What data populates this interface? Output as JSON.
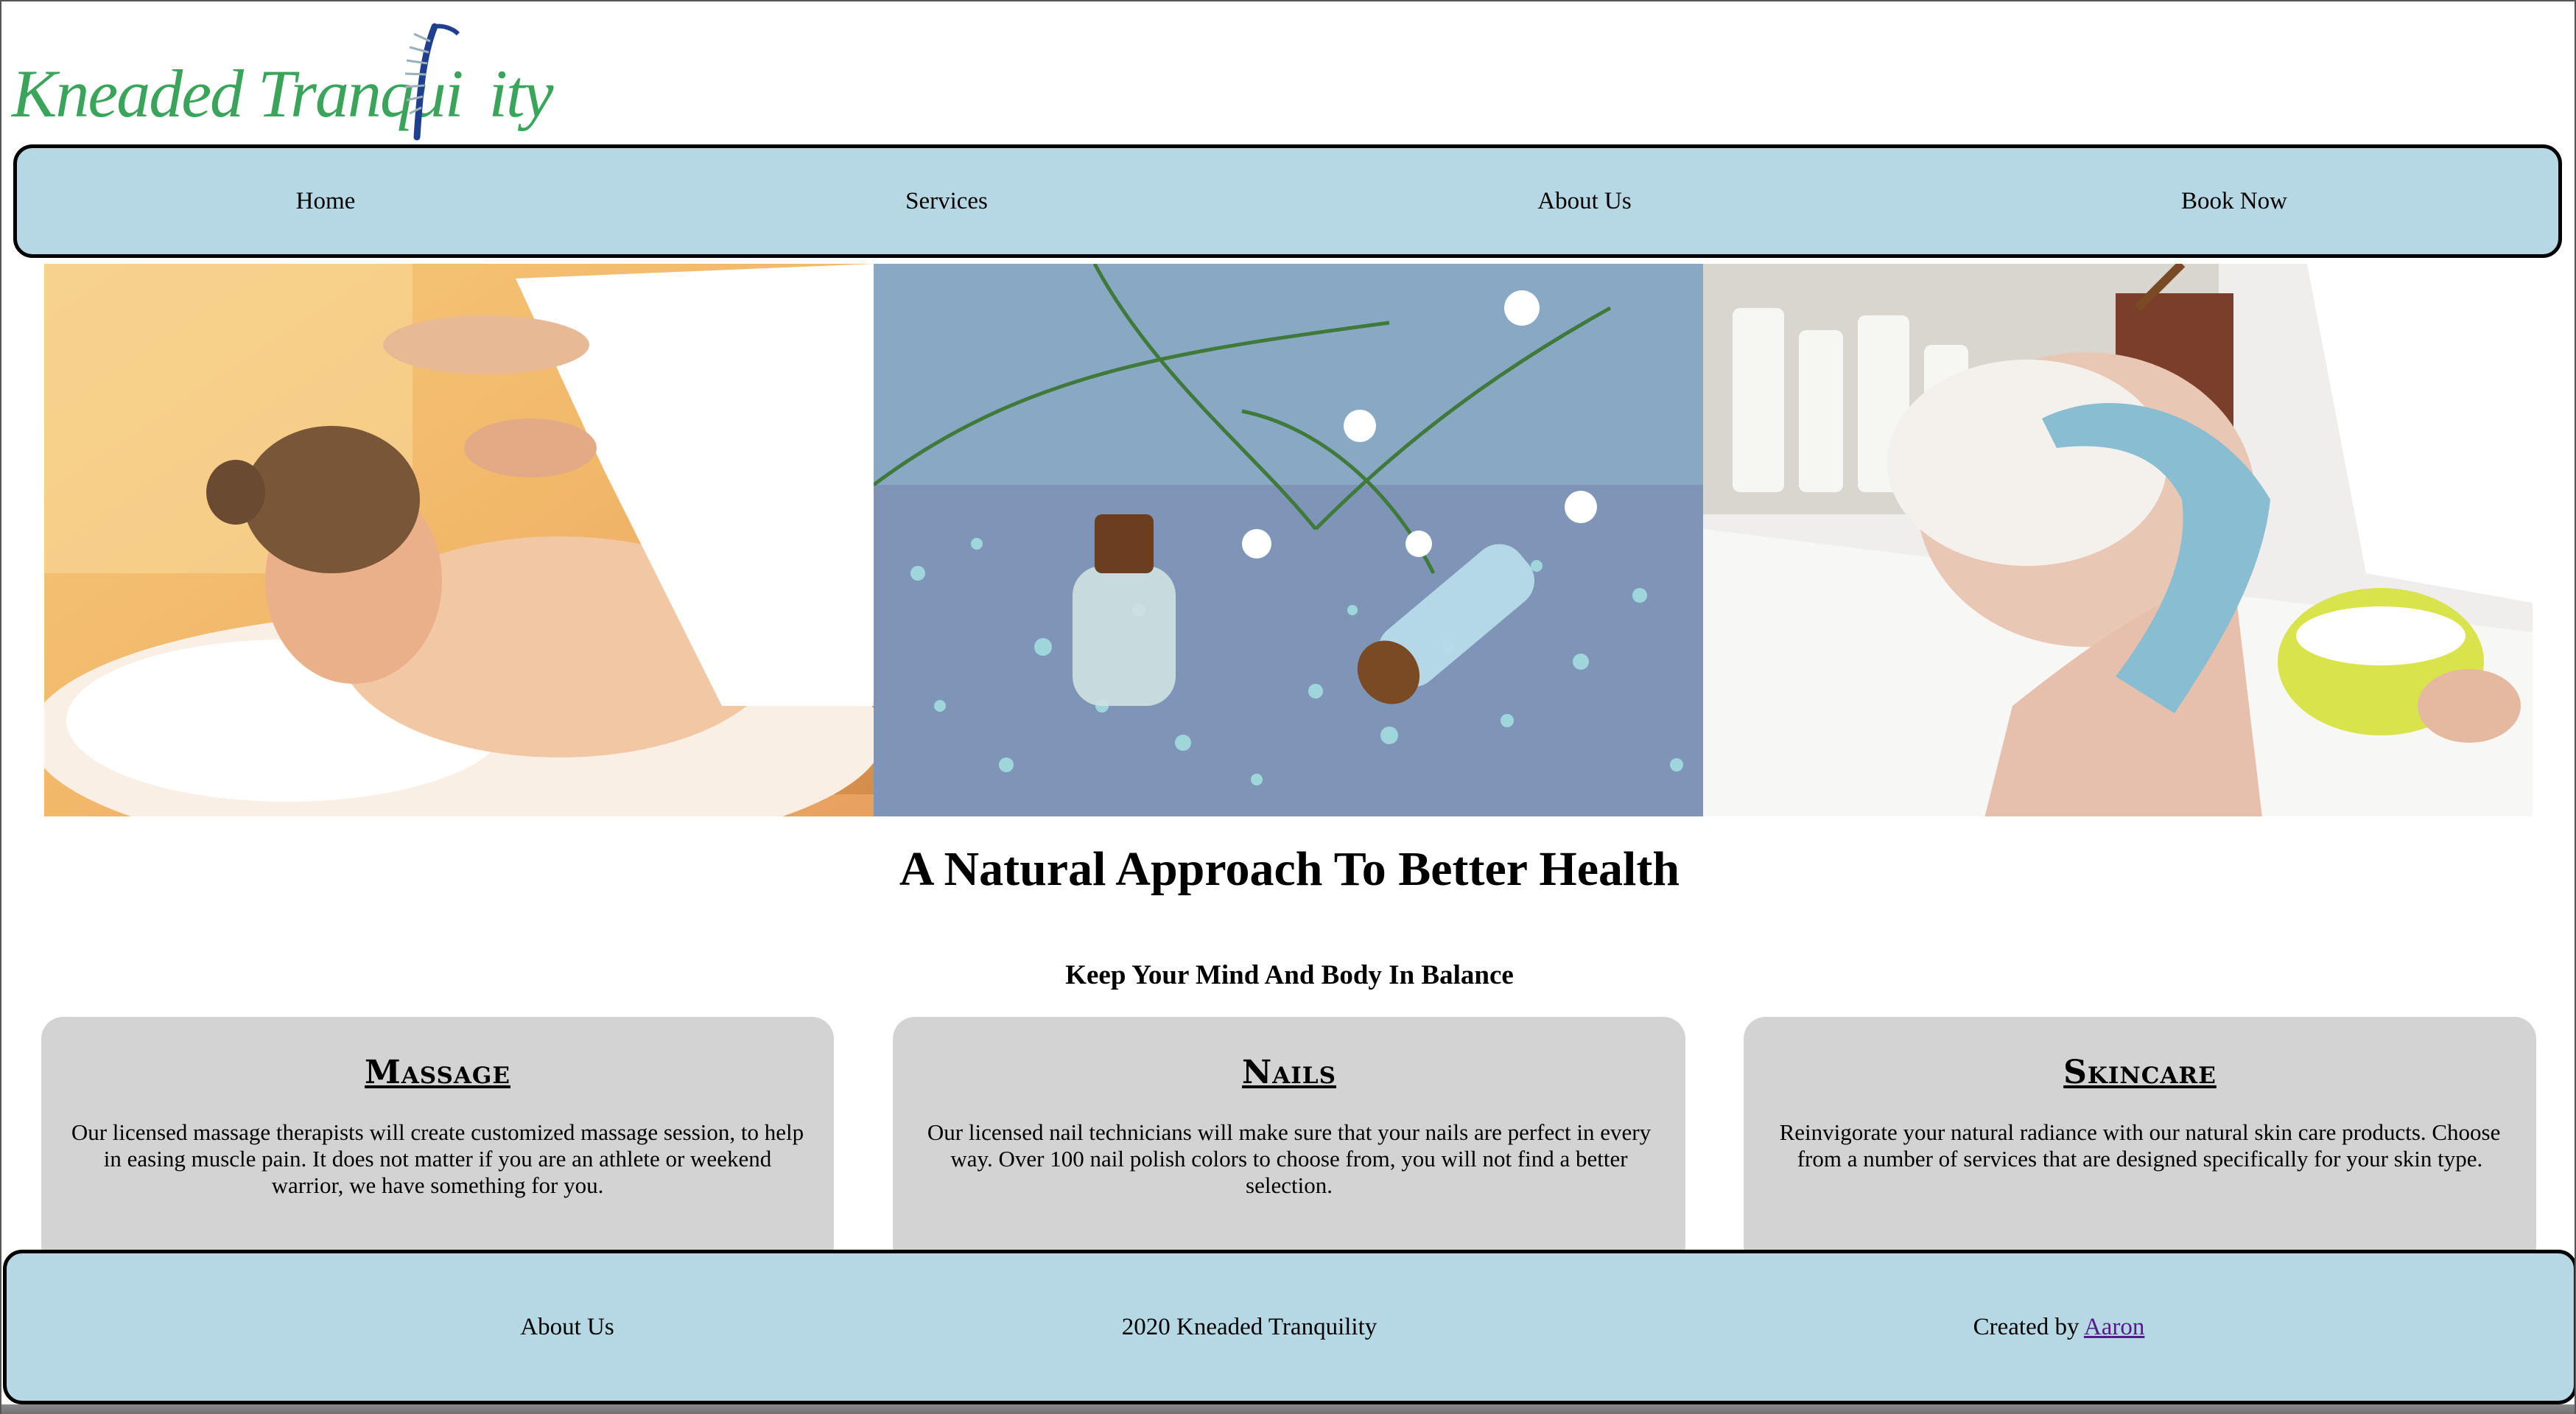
{
  "logo": {
    "text_before": "Kneaded Tranqui",
    "text_after": "ity"
  },
  "nav": {
    "items": [
      {
        "label": "Home"
      },
      {
        "label": "Services"
      },
      {
        "label": "About Us"
      },
      {
        "label": "Book Now"
      }
    ]
  },
  "hero": {
    "images": [
      {
        "icon": "massage-photo"
      },
      {
        "icon": "bath-salts-photo"
      },
      {
        "icon": "facial-mask-photo"
      }
    ]
  },
  "main": {
    "heading": "A Natural Approach To Better Health",
    "subheading": "Keep Your Mind And Body In Balance",
    "cards": [
      {
        "title": "Massage",
        "text": "Our licensed massage therapists will create customized massage session, to help in easing muscle pain. It does not matter if you are an athlete or weekend warrior, we have something for you."
      },
      {
        "title": "Nails",
        "text": "Our licensed nail technicians will make sure that your nails are perfect in every way. Over 100 nail polish colors to choose from, you will not find a better selection."
      },
      {
        "title": "Skincare",
        "text": "Reinvigorate your natural radiance with our natural skin care products. Choose from a number of services that are designed specifically for your skin type."
      }
    ]
  },
  "footer": {
    "about": "About Us",
    "copyright": "2020 Kneaded Tranquility",
    "created_prefix": "Created by",
    "author_link": "Aaron"
  },
  "colors": {
    "nav_bg": "#b5d8e4",
    "card_bg": "#d3d3d3",
    "logo_green": "#3aa55a",
    "logo_blue": "#1f3f8f",
    "link": "#551a8b"
  }
}
